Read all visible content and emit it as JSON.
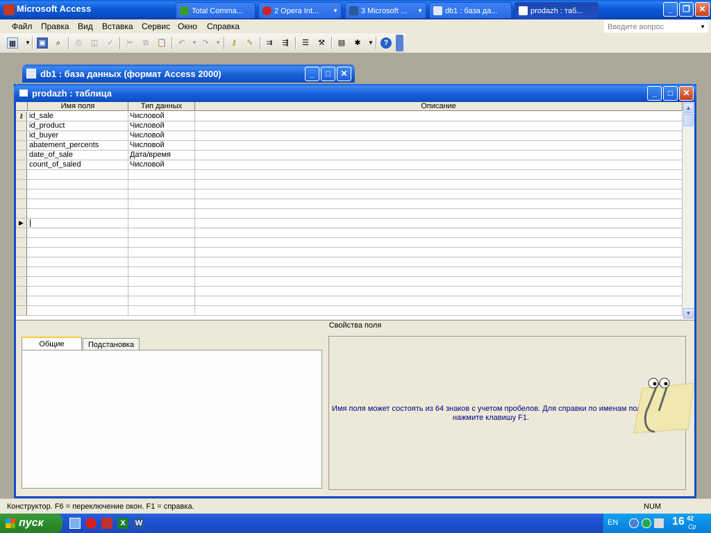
{
  "app": {
    "title": "Microsoft Access",
    "ask_placeholder": "Введите вопрос"
  },
  "menu": [
    "Файл",
    "Правка",
    "Вид",
    "Вставка",
    "Сервис",
    "Окно",
    "Справка"
  ],
  "toolbar_icons": [
    "view-icon",
    "save-icon",
    "search-icon",
    "print-icon",
    "preview-icon",
    "spell-icon",
    "cut-icon",
    "copy-icon",
    "paste-icon",
    "undo-icon",
    "redo-icon",
    "key-icon",
    "build-icon",
    "insert-row-icon",
    "delete-row-icon",
    "properties-icon",
    "builder-icon",
    "database-window-icon",
    "new-object-icon",
    "help-icon"
  ],
  "db_window": {
    "title": "db1 : база данных (формат Access 2000)"
  },
  "table_window": {
    "title": "prodazh : таблица",
    "headers": [
      "Имя поля",
      "Тип данных",
      "Описание"
    ],
    "rows": [
      {
        "name": "id_sale",
        "type": "Числовой",
        "primary_key": true
      },
      {
        "name": "id_product",
        "type": "Числовой"
      },
      {
        "name": "id_buyer",
        "type": "Числовой"
      },
      {
        "name": "abatement_percents",
        "type": "Числовой"
      },
      {
        "name": "date_of_sale",
        "type": "Дата/время"
      },
      {
        "name": "count_of_saled",
        "type": "Числовой"
      }
    ],
    "properties_label": "Свойства поля",
    "tabs": [
      "Общие",
      "Подстановка"
    ],
    "hint": "Имя поля может состоять из 64 знаков с учетом пробелов.  Для справки по именам полей нажмите клавишу F1."
  },
  "status": {
    "text": "Конструктор.  F6 = переключение окон.  F1 = справка.",
    "num": "NUM"
  },
  "taskbar": {
    "start": "пуск",
    "tasks": [
      "Total Comma...",
      "2 Opera Int...",
      "3 Microsoft ...",
      "db1 : база да...",
      "prodazh : таб..."
    ],
    "lang": "EN",
    "time_h": "16",
    "time_m": "42",
    "day": "Ср"
  },
  "colors": {
    "title_blue": "#0a5bd8",
    "face": "#ece9d8",
    "start_green": "#2c8d2c",
    "hint_text": "#000080"
  }
}
